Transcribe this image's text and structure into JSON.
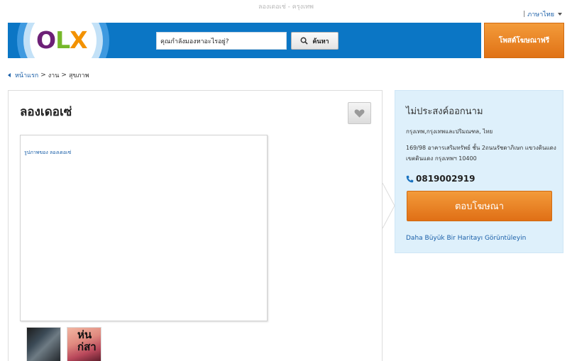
{
  "page": {
    "window_title": "ลองเดอเช่ - ครุงเทพ"
  },
  "header": {
    "language_label": "ภาษาไทย",
    "logo_letters": [
      "O",
      "L",
      "X"
    ],
    "search_placeholder": "คุณกำลังมองหาอะไรอยู่?",
    "search_button_label": "ค้นหา",
    "post_ad_label": "โพสต์โฆษณาฟรี",
    "colors": {
      "brand_blue": "#0b76c5",
      "accent_orange": "#e8801f"
    }
  },
  "breadcrumb": {
    "home": "หน้าแรก",
    "separator": ">",
    "level1": "งาน",
    "level2": "สุขภาพ"
  },
  "ad": {
    "title": "ลองเดอเซ่",
    "favorite_icon": "heart-icon",
    "photo_alt": "รูปภาพของ ลองเดอเซ่",
    "thumbnail_overlay_text": "ห่น\nก่สา"
  },
  "contact": {
    "seller_name": "ไม่ประสงค์ออกนาม",
    "location": "กรุงเทพ,กรุงเทพและปริมณฑล, ไทย",
    "address": "169/98 อาคารเสริมทรัพย์ ชั้น 2ถนนรัชดาภิเษก แขวงดินแดง เขตดินแดง กรุงเทพฯ 10400",
    "phone": "0819002919",
    "phone_icon": "phone-icon",
    "reply_button_label": "ตอบโฆษณา",
    "map_link": "Daha Büyük Bir Haritayı Görüntüleyin"
  }
}
